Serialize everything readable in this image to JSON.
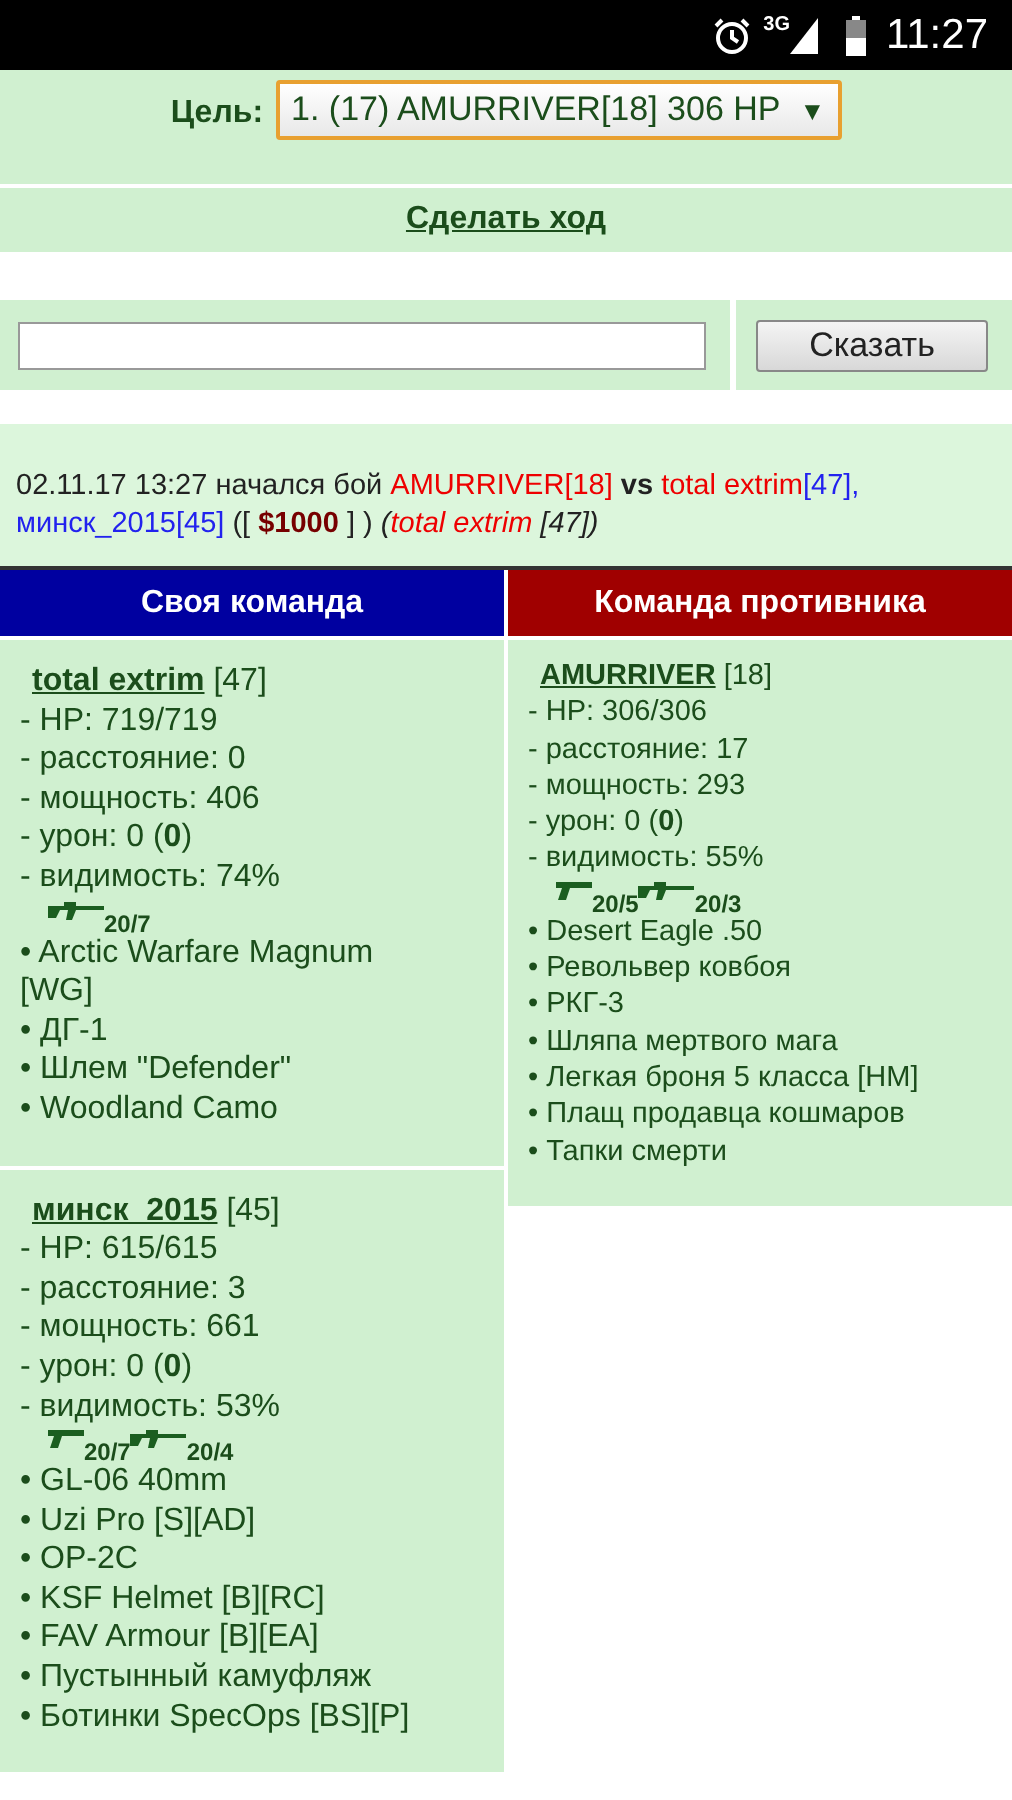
{
  "status_bar": {
    "network": "3G",
    "time": "11:27"
  },
  "target": {
    "label": "Цель:",
    "value": "1. (17) AMURRIVER[18] 306 HP",
    "arrow": "▼"
  },
  "move_link": "Сделать ход",
  "chat": {
    "button": "Сказать"
  },
  "log": [
    {
      "kind": "plain",
      "text": "02.11.17 13:27 начался бой "
    },
    {
      "kind": "red",
      "text": "AMURRIVER"
    },
    {
      "kind": "red",
      "text": "[18]"
    },
    {
      "kind": "bold",
      "text": " vs "
    },
    {
      "kind": "red",
      "text": "total extrim"
    },
    {
      "kind": "blue",
      "text": "[47], "
    },
    {
      "kind": "blue",
      "text": "минск_2015"
    },
    {
      "kind": "blue",
      "text": "[45]"
    },
    {
      "kind": "plain",
      "text": " ([ "
    },
    {
      "kind": "money",
      "text": "$1000"
    },
    {
      "kind": "plain",
      "text": " ] ) "
    },
    {
      "kind": "italic",
      "text": "("
    },
    {
      "kind": "italic-red",
      "text": "total extrim"
    },
    {
      "kind": "italic",
      "text": " [47])"
    }
  ],
  "teams": [
    {
      "title": "Своя команда",
      "kind": "own",
      "players": [
        {
          "name": "total extrim",
          "level": "[47]",
          "stats": [
            "- HP: 719/719",
            "- расстояние: 0",
            "- мощность: 406",
            "- урон: 0 (**0**)",
            "- видимость: 74%"
          ],
          "weapons": [
            {
              "kind": "rifle",
              "text": "20/7"
            }
          ],
          "items": [
            "• Arctic Warfare Magnum [WG]",
            "• ДГ-1",
            "• Шлем \"Defender\"",
            "• Woodland Camo"
          ]
        },
        {
          "name": "минск_2015",
          "level": "[45]",
          "stats": [
            "- HP: 615/615",
            "- расстояние: 3",
            "- мощность: 661",
            "- урон: 0 (**0**)",
            "- видимость: 53%"
          ],
          "weapons": [
            {
              "kind": "pistol",
              "text": "20/7"
            },
            {
              "kind": "rifle",
              "text": "20/4"
            }
          ],
          "items": [
            "• GL-06 40mm",
            "• Uzi Pro [S][AD]",
            "• OP-2C",
            "• KSF Helmet [B][RC]",
            "• FAV Armour [B][EA]",
            "• Пустынный камуфляж",
            "• Ботинки SpecOps [BS][P]"
          ]
        }
      ]
    },
    {
      "title": "Команда противника",
      "kind": "enemy",
      "players": [
        {
          "name": "AMURRIVER",
          "level": "[18]",
          "stats": [
            "- HP: 306/306",
            "- расстояние: 17",
            "- мощность: 293",
            "- урон: 0 (**0**)",
            "- видимость: 55%"
          ],
          "weapons": [
            {
              "kind": "pistol",
              "text": "20/5"
            },
            {
              "kind": "rifle",
              "text": "20/3"
            }
          ],
          "items": [
            "• Desert Eagle .50",
            "• Револьвер ковбоя",
            "• РКГ-3",
            "• Шляпа мертвого мага",
            "• Легкая броня 5 класса [НМ]",
            "• Плащ продавца кошмаров",
            "• Тапки смерти"
          ]
        }
      ]
    }
  ]
}
